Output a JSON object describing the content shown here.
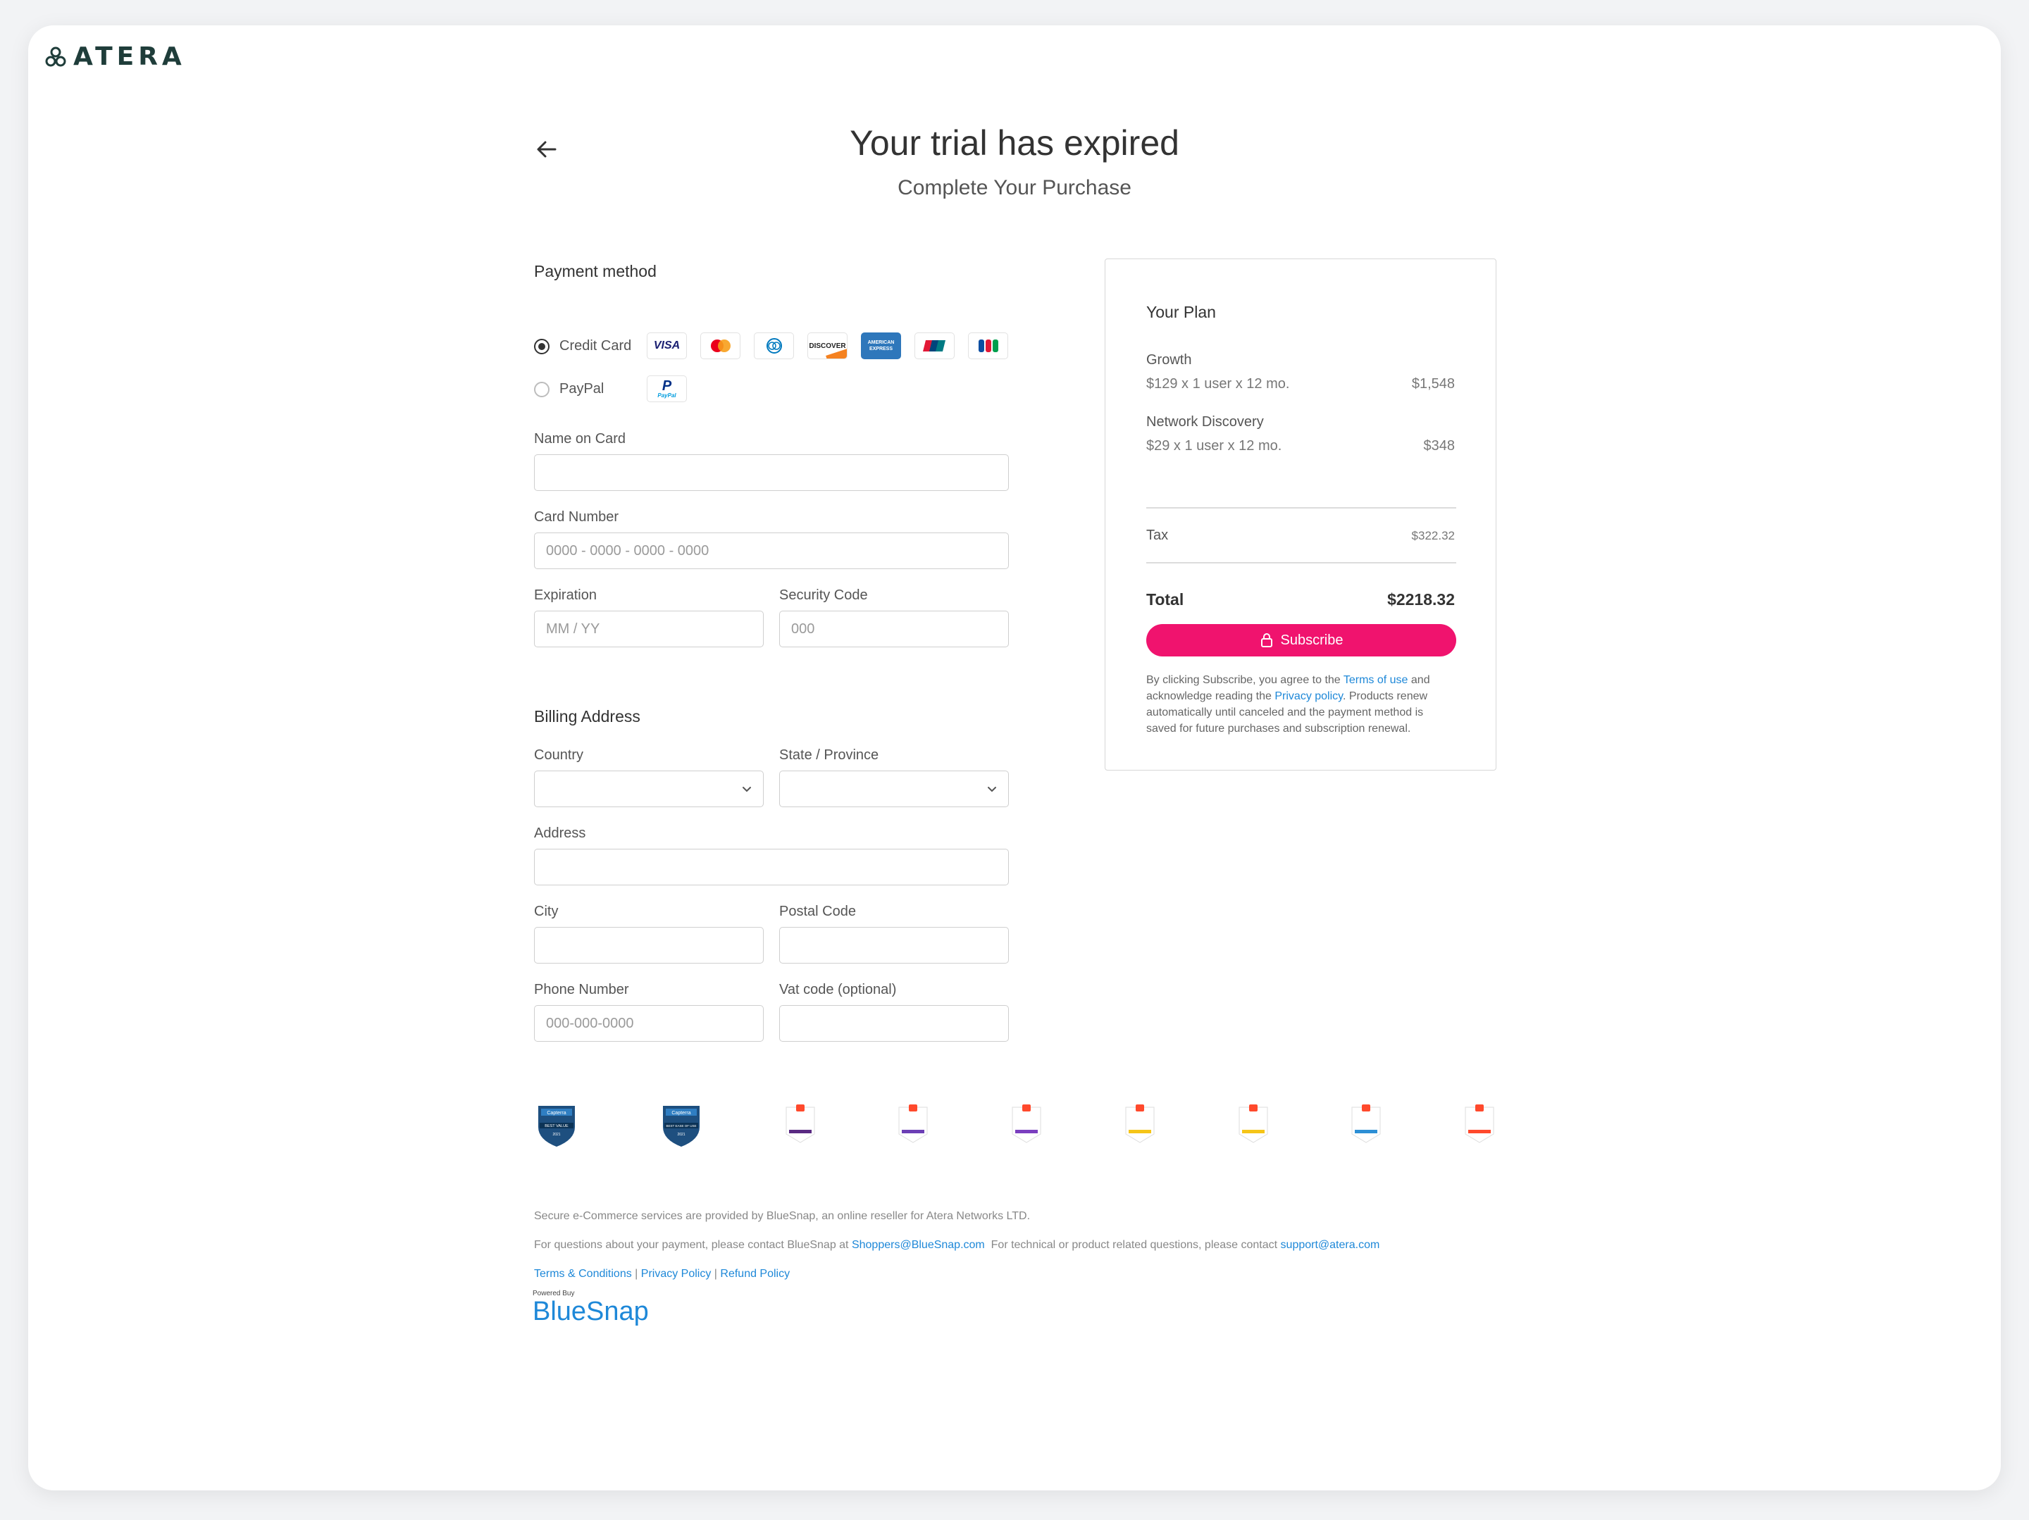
{
  "brand": {
    "name": "ATERA"
  },
  "header": {
    "title": "Your trial has expired",
    "subtitle": "Complete Your Purchase"
  },
  "payment": {
    "heading": "Payment method",
    "options": [
      {
        "label": "Credit Card",
        "selected": true
      },
      {
        "label": "PayPal",
        "selected": false
      }
    ],
    "card_brands": [
      "VISA",
      "Mastercard",
      "Diners Club",
      "DISCOVER",
      "AMERICAN EXPRESS",
      "UnionPay",
      "JCB"
    ],
    "paypal_brand": "PayPal"
  },
  "card_form": {
    "name_label": "Name on Card",
    "name_value": "",
    "name_placeholder": "",
    "number_label": "Card Number",
    "number_placeholder": "0000 - 0000 - 0000 - 0000",
    "exp_label": "Expiration",
    "exp_placeholder": "MM / YY",
    "cvc_label": "Security Code",
    "cvc_placeholder": "000"
  },
  "billing": {
    "heading": "Billing Address",
    "country_label": "Country",
    "country_value": "",
    "state_label": "State / Province",
    "state_value": "",
    "address_label": "Address",
    "address_value": "",
    "city_label": "City",
    "city_value": "",
    "postal_label": "Postal Code",
    "postal_value": "",
    "phone_label": "Phone Number",
    "phone_placeholder": "000-000-0000",
    "vat_label": "Vat code (optional)",
    "vat_value": ""
  },
  "plan": {
    "heading": "Your Plan",
    "items": [
      {
        "name": "Growth",
        "detail": "$129 x 1 user x 12 mo.",
        "price": "$1,548"
      },
      {
        "name": "Network Discovery",
        "detail": "$29 x 1 user x 12 mo.",
        "price": "$348"
      }
    ],
    "tax_label": "Tax",
    "tax_value": "$322.32",
    "total_label": "Total",
    "total_value": "$2218.32",
    "subscribe_label": "Subscribe",
    "legal": {
      "p1": "By clicking Subscribe, you agree to the ",
      "terms_link": "Terms of use",
      "p2": " and acknowledge reading the ",
      "privacy_link": "Privacy policy",
      "p3": ". Products renew automatically until canceled and the payment method is saved for future purchases and subscription renewal."
    }
  },
  "badges": [
    {
      "vendor": "Capterra",
      "text": "BEST VALUE",
      "year": "2021"
    },
    {
      "vendor": "Capterra",
      "text": "BEST EASE OF USE",
      "year": "2021"
    },
    {
      "vendor": "G2",
      "text": "",
      "year": ""
    },
    {
      "vendor": "G2",
      "text": "",
      "year": ""
    },
    {
      "vendor": "G2",
      "text": "",
      "year": ""
    },
    {
      "vendor": "G2",
      "text": "",
      "year": ""
    },
    {
      "vendor": "G2",
      "text": "",
      "year": ""
    },
    {
      "vendor": "G2",
      "text": "",
      "year": ""
    },
    {
      "vendor": "G2",
      "text": "",
      "year": ""
    }
  ],
  "footer": {
    "line1": "Secure e-Commerce services are provided by BlueSnap, an online reseller for Atera Networks LTD.",
    "line2_a": "For questions about your payment, please contact BlueSnap at ",
    "shoppers_email": "Shoppers@BlueSnap.com",
    "line2_b": "  For technical or product related questions, please contact ",
    "support_email": "support@atera.com",
    "terms_link": "Terms & Conditions",
    "privacy_link": "Privacy Policy",
    "refund_link": "Refund Policy",
    "powered_by": "Powered Buy",
    "bluesnap": "BlueSnap"
  },
  "colors": {
    "accent": "#f0136e",
    "link": "#1e88d8",
    "capterra": "#1e4f7f"
  }
}
